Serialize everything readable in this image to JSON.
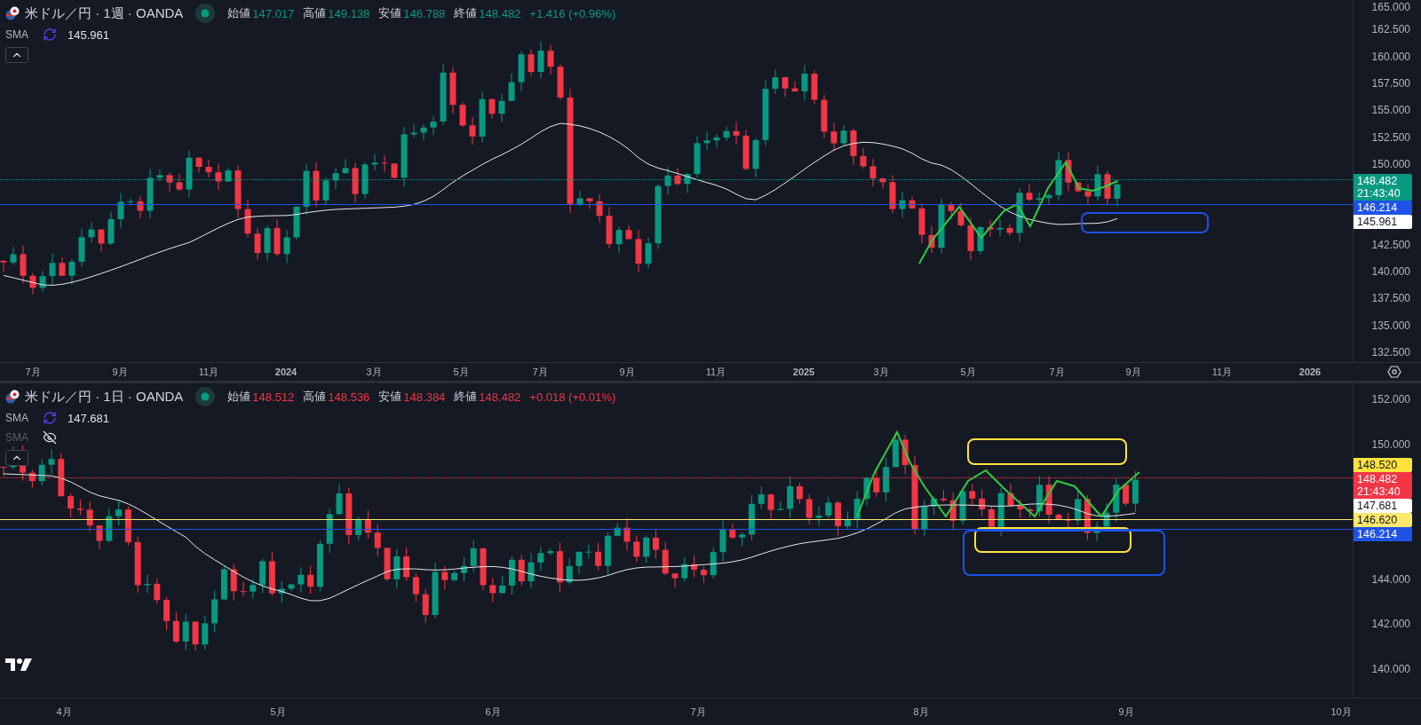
{
  "panes": [
    {
      "legend": {
        "symbol": "米ドル／円 · 1週 · OANDA",
        "bearish": false,
        "ohlc": [
          {
            "label": "始値",
            "value": "147.017"
          },
          {
            "label": "高値",
            "value": "149.138"
          },
          {
            "label": "安値",
            "value": "146.788"
          },
          {
            "label": "終値",
            "value": "148.482"
          }
        ],
        "change": "+1.416 (+0.96%)"
      },
      "indicators": [
        {
          "name": "SMA",
          "value": "145.961",
          "hidden": false
        }
      ],
      "price_ticks": [
        "165.000",
        "162.500",
        "160.000",
        "157.500",
        "155.000",
        "152.500",
        "150.000",
        "142.500",
        "140.000",
        "137.500",
        "135.000",
        "132.500"
      ],
      "price_labels": [
        {
          "value": "148.482",
          "time": "21:43:40",
          "color": "#089981",
          "level_line": true,
          "dotted": true
        },
        {
          "value": "146.214",
          "color": "#1e53e5",
          "level_line": true,
          "dotted": false
        },
        {
          "value": "145.961",
          "color": "#ffffff",
          "level_line": false
        }
      ],
      "time_ticks": [
        {
          "label": "7月",
          "bold": false
        },
        {
          "label": "9月",
          "bold": false
        },
        {
          "label": "11月",
          "bold": false
        },
        {
          "label": "2024",
          "bold": true
        },
        {
          "label": "3月",
          "bold": false
        },
        {
          "label": "5月",
          "bold": false
        },
        {
          "label": "7月",
          "bold": false
        },
        {
          "label": "9月",
          "bold": false
        },
        {
          "label": "11月",
          "bold": false
        },
        {
          "label": "2025",
          "bold": true
        },
        {
          "label": "3月",
          "bold": false
        },
        {
          "label": "5月",
          "bold": false
        },
        {
          "label": "7月",
          "bold": false
        },
        {
          "label": "9月",
          "bold": false
        },
        {
          "label": "11月",
          "bold": false
        },
        {
          "label": "2026",
          "bold": true
        }
      ]
    },
    {
      "legend": {
        "symbol": "米ドル／円 · 1日 · OANDA",
        "bearish": true,
        "ohlc": [
          {
            "label": "始値",
            "value": "148.512"
          },
          {
            "label": "高値",
            "value": "148.536"
          },
          {
            "label": "安値",
            "value": "148.384"
          },
          {
            "label": "終値",
            "value": "148.482"
          }
        ],
        "change": "+0.018 (+0.01%)"
      },
      "indicators": [
        {
          "name": "SMA",
          "value": "147.681",
          "hidden": false
        },
        {
          "name": "SMA",
          "hidden": true
        }
      ],
      "price_ticks": [
        "152.000",
        "150.000",
        "144.000",
        "142.000",
        "140.000"
      ],
      "price_labels": [
        {
          "value": "148.520",
          "color": "#ffe23b",
          "level_line": false
        },
        {
          "value": "148.482",
          "time": "21:43:40",
          "color": "#f23645",
          "level_line": true,
          "dotted": true
        },
        {
          "value": "147.681",
          "color": "#ffffff",
          "level_line": false
        },
        {
          "value": "146.620",
          "color": "#ffe86b",
          "level_line": true,
          "dotted": false
        },
        {
          "value": "146.214",
          "color": "#1e53e5",
          "level_line": true,
          "dotted": false
        }
      ],
      "time_ticks": [
        {
          "label": "4月",
          "bold": false
        },
        {
          "label": "5月",
          "bold": false
        },
        {
          "label": "6月",
          "bold": false
        },
        {
          "label": "7月",
          "bold": false
        },
        {
          "label": "8月",
          "bold": false
        },
        {
          "label": "9月",
          "bold": false
        },
        {
          "label": "10月",
          "bold": false
        }
      ]
    }
  ]
}
